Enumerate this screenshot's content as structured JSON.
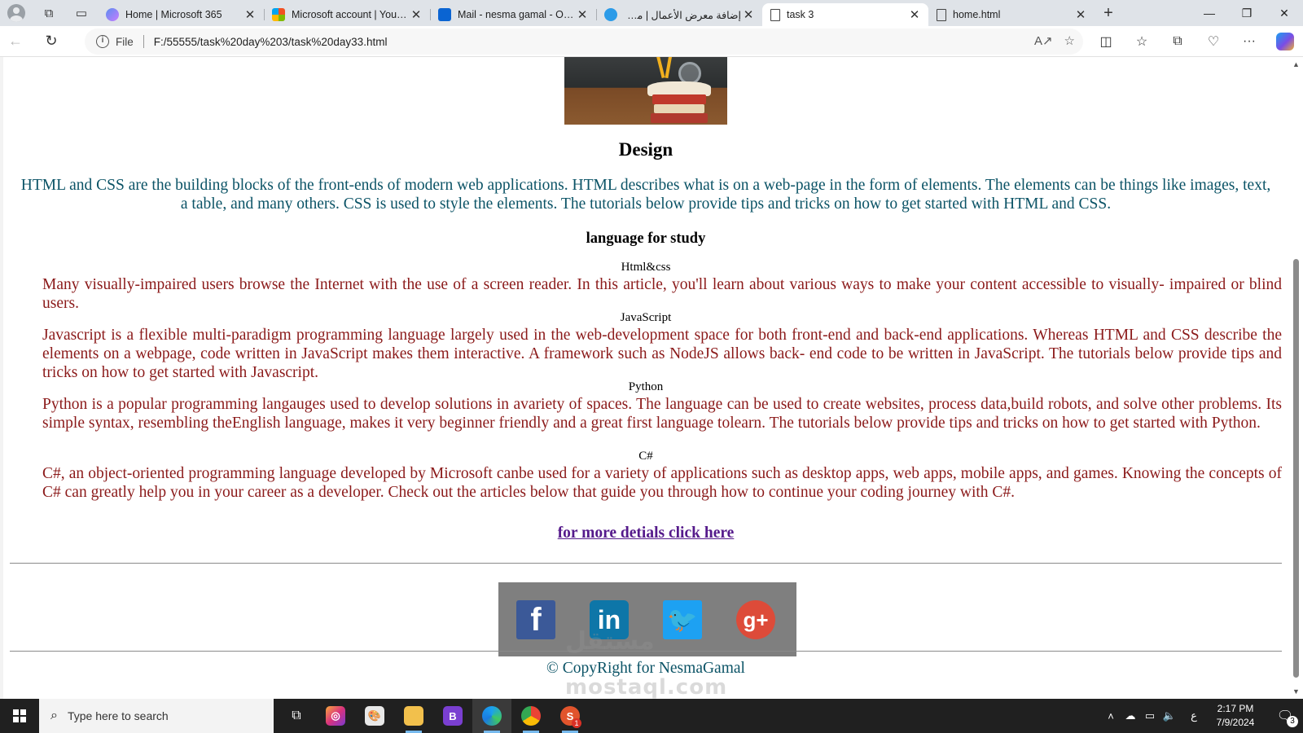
{
  "browser": {
    "tabs": [
      {
        "title": "Home | Microsoft 365",
        "icon": "microsoft365-icon"
      },
      {
        "title": "Microsoft account | Your pr",
        "icon": "microsoft-logo-icon"
      },
      {
        "title": "Mail - nesma gamal - Outlo",
        "icon": "outlook-icon"
      },
      {
        "title": "إضافة معرض الأعمال | مستق",
        "icon": "mostaql-icon"
      },
      {
        "title": "task 3",
        "icon": "page-icon"
      },
      {
        "title": "home.html",
        "icon": "page-icon"
      }
    ],
    "active_tab": 4,
    "address": {
      "scheme_label": "File",
      "url": "F:/55555/task%20day%203/task%20day33.html"
    }
  },
  "page": {
    "heading": "Design",
    "intro": "HTML and CSS are the building blocks of the front-ends of modern web applications. HTML describes what is on a web-page in the form of elements. The elements can be things like images, text, a table, and many others. CSS is used to style the elements. The tutorials below provide tips and tricks on how to get started with HTML and CSS.",
    "section_title": "language for study",
    "languages": [
      {
        "name": "Html&css",
        "description": "Many visually-impaired users browse the Internet with the use of a screen reader. In this article, you'll learn about various ways to make your content accessible to visually- impaired or blind users."
      },
      {
        "name": "JavaScript",
        "description": "Javascript is a flexible multi-paradigm programming language largely used in the web-development space for both front-end and back-end applications. Whereas HTML and CSS describe the elements on a webpage, code written in JavaScript makes them interactive. A framework such as NodeJS allows back- end code to be written in JavaScript. The tutorials below provide tips and tricks on how to get started with Javascript."
      },
      {
        "name": "Python",
        "description": "Python is a popular programming langauges used to develop solutions in avariety of spaces. The language can be used to create websites, process data,build robots, and solve other problems. Its simple syntax, resembling theEnglish language, makes it very beginner friendly and a great first language tolearn. The tutorials below provide tips and tricks on how to get started with Python."
      },
      {
        "name": "C#",
        "description": "C#, an object-oriented programming language developed by Microsoft canbe used for a variety of applications such as desktop apps, web apps, mobile apps, and games. Knowing the concepts of C# can greatly help you in your career as a developer. Check out the articles below that guide you through how to continue your coding journey with C#."
      }
    ],
    "more_link": "for more detials click here",
    "social": [
      {
        "name": "facebook-icon",
        "glyph": "f"
      },
      {
        "name": "linkedin-icon",
        "glyph": "in"
      },
      {
        "name": "twitter-icon",
        "glyph": "🐦"
      },
      {
        "name": "google-plus-icon",
        "glyph": "g+"
      }
    ],
    "copyright": "© CopyRight for NesmaGamal",
    "watermark": {
      "arabic": "مستقل",
      "latin": "mostaql.com"
    }
  },
  "taskbar": {
    "search_placeholder": "Type here to search",
    "tray_lang": "ع",
    "time": "2:17 PM",
    "date": "7/9/2024",
    "notification_count": "3",
    "app_badge": "1"
  },
  "colors": {
    "intro_text": "#0b5366",
    "body_text": "#8b1a1a",
    "link": "#551a8b"
  }
}
